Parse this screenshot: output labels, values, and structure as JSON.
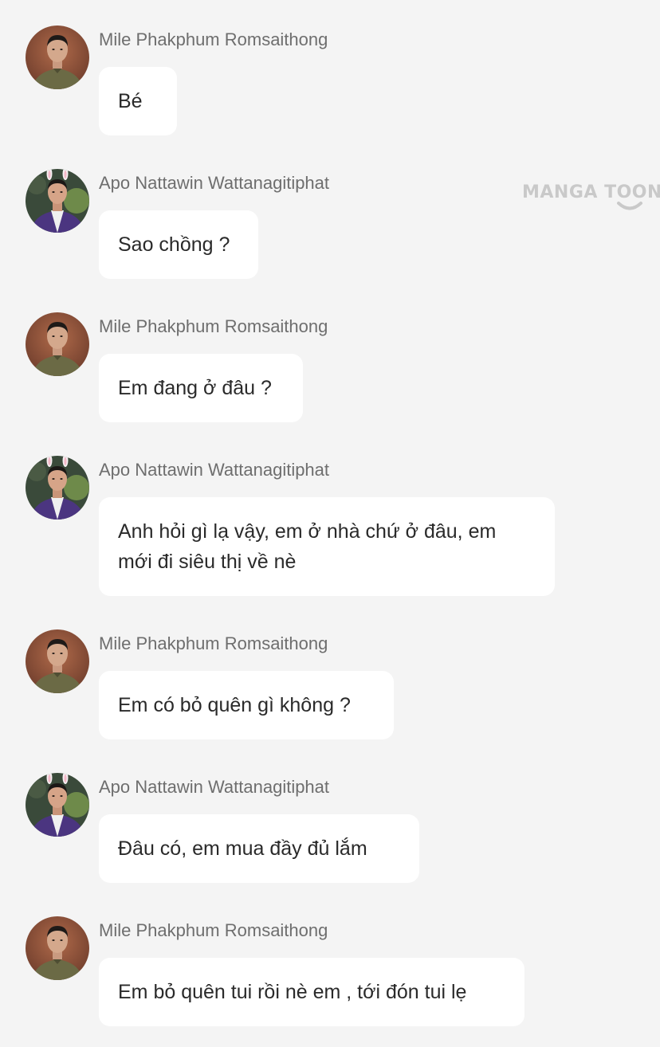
{
  "watermark": {
    "text": "MANGA TOON"
  },
  "participants": {
    "mile": {
      "name": "Mile Phakphum Romsaithong",
      "avatar_icon": "man-portrait-olive-shirt"
    },
    "apo": {
      "name": "Apo Nattawin Wattanagitiphat",
      "avatar_icon": "man-portrait-bunny-ears-purple-jacket"
    }
  },
  "messages": [
    {
      "sender": "Mile Phakphum Romsaithong",
      "text": "Bé"
    },
    {
      "sender": "Apo Nattawin Wattanagitiphat",
      "text": "Sao chồng ?"
    },
    {
      "sender": "Mile Phakphum Romsaithong",
      "text": "Em đang ở đâu ?"
    },
    {
      "sender": "Apo Nattawin Wattanagitiphat",
      "text": "Anh hỏi gì lạ vậy, em ở nhà chứ ở đâu, em mới đi siêu thị về nè"
    },
    {
      "sender": "Mile Phakphum Romsaithong",
      "text": "Em có bỏ quên gì không ?"
    },
    {
      "sender": "Apo Nattawin Wattanagitiphat",
      "text": "Đâu có, em mua đầy đủ lắm"
    },
    {
      "sender": "Mile Phakphum Romsaithong",
      "text": "Em bỏ quên tui rồi nè em , tới đón tui lẹ"
    }
  ],
  "colors": {
    "background": "#f4f4f4",
    "bubble": "#ffffff",
    "sender_text": "#6e6e6e",
    "message_text": "#2a2a2a",
    "watermark": "#c9c9c9"
  }
}
